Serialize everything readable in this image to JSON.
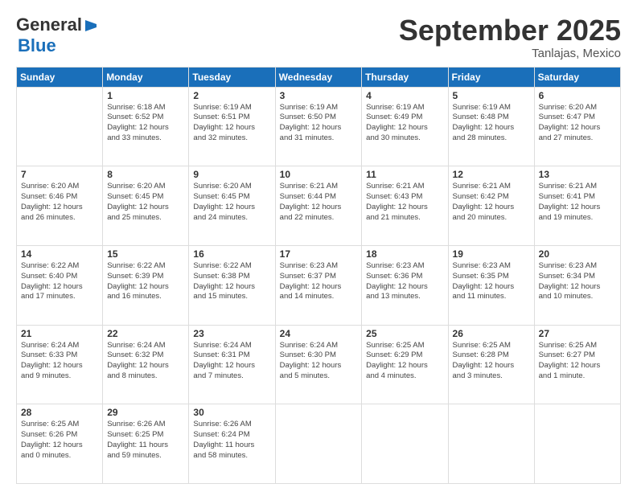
{
  "header": {
    "logo_general": "General",
    "logo_blue": "Blue",
    "title": "September 2025",
    "location": "Tanlajas, Mexico"
  },
  "calendar": {
    "headers": [
      "Sunday",
      "Monday",
      "Tuesday",
      "Wednesday",
      "Thursday",
      "Friday",
      "Saturday"
    ],
    "weeks": [
      [
        {
          "num": "",
          "info": ""
        },
        {
          "num": "1",
          "info": "Sunrise: 6:18 AM\nSunset: 6:52 PM\nDaylight: 12 hours\nand 33 minutes."
        },
        {
          "num": "2",
          "info": "Sunrise: 6:19 AM\nSunset: 6:51 PM\nDaylight: 12 hours\nand 32 minutes."
        },
        {
          "num": "3",
          "info": "Sunrise: 6:19 AM\nSunset: 6:50 PM\nDaylight: 12 hours\nand 31 minutes."
        },
        {
          "num": "4",
          "info": "Sunrise: 6:19 AM\nSunset: 6:49 PM\nDaylight: 12 hours\nand 30 minutes."
        },
        {
          "num": "5",
          "info": "Sunrise: 6:19 AM\nSunset: 6:48 PM\nDaylight: 12 hours\nand 28 minutes."
        },
        {
          "num": "6",
          "info": "Sunrise: 6:20 AM\nSunset: 6:47 PM\nDaylight: 12 hours\nand 27 minutes."
        }
      ],
      [
        {
          "num": "7",
          "info": "Sunrise: 6:20 AM\nSunset: 6:46 PM\nDaylight: 12 hours\nand 26 minutes."
        },
        {
          "num": "8",
          "info": "Sunrise: 6:20 AM\nSunset: 6:45 PM\nDaylight: 12 hours\nand 25 minutes."
        },
        {
          "num": "9",
          "info": "Sunrise: 6:20 AM\nSunset: 6:45 PM\nDaylight: 12 hours\nand 24 minutes."
        },
        {
          "num": "10",
          "info": "Sunrise: 6:21 AM\nSunset: 6:44 PM\nDaylight: 12 hours\nand 22 minutes."
        },
        {
          "num": "11",
          "info": "Sunrise: 6:21 AM\nSunset: 6:43 PM\nDaylight: 12 hours\nand 21 minutes."
        },
        {
          "num": "12",
          "info": "Sunrise: 6:21 AM\nSunset: 6:42 PM\nDaylight: 12 hours\nand 20 minutes."
        },
        {
          "num": "13",
          "info": "Sunrise: 6:21 AM\nSunset: 6:41 PM\nDaylight: 12 hours\nand 19 minutes."
        }
      ],
      [
        {
          "num": "14",
          "info": "Sunrise: 6:22 AM\nSunset: 6:40 PM\nDaylight: 12 hours\nand 17 minutes."
        },
        {
          "num": "15",
          "info": "Sunrise: 6:22 AM\nSunset: 6:39 PM\nDaylight: 12 hours\nand 16 minutes."
        },
        {
          "num": "16",
          "info": "Sunrise: 6:22 AM\nSunset: 6:38 PM\nDaylight: 12 hours\nand 15 minutes."
        },
        {
          "num": "17",
          "info": "Sunrise: 6:23 AM\nSunset: 6:37 PM\nDaylight: 12 hours\nand 14 minutes."
        },
        {
          "num": "18",
          "info": "Sunrise: 6:23 AM\nSunset: 6:36 PM\nDaylight: 12 hours\nand 13 minutes."
        },
        {
          "num": "19",
          "info": "Sunrise: 6:23 AM\nSunset: 6:35 PM\nDaylight: 12 hours\nand 11 minutes."
        },
        {
          "num": "20",
          "info": "Sunrise: 6:23 AM\nSunset: 6:34 PM\nDaylight: 12 hours\nand 10 minutes."
        }
      ],
      [
        {
          "num": "21",
          "info": "Sunrise: 6:24 AM\nSunset: 6:33 PM\nDaylight: 12 hours\nand 9 minutes."
        },
        {
          "num": "22",
          "info": "Sunrise: 6:24 AM\nSunset: 6:32 PM\nDaylight: 12 hours\nand 8 minutes."
        },
        {
          "num": "23",
          "info": "Sunrise: 6:24 AM\nSunset: 6:31 PM\nDaylight: 12 hours\nand 7 minutes."
        },
        {
          "num": "24",
          "info": "Sunrise: 6:24 AM\nSunset: 6:30 PM\nDaylight: 12 hours\nand 5 minutes."
        },
        {
          "num": "25",
          "info": "Sunrise: 6:25 AM\nSunset: 6:29 PM\nDaylight: 12 hours\nand 4 minutes."
        },
        {
          "num": "26",
          "info": "Sunrise: 6:25 AM\nSunset: 6:28 PM\nDaylight: 12 hours\nand 3 minutes."
        },
        {
          "num": "27",
          "info": "Sunrise: 6:25 AM\nSunset: 6:27 PM\nDaylight: 12 hours\nand 1 minute."
        }
      ],
      [
        {
          "num": "28",
          "info": "Sunrise: 6:25 AM\nSunset: 6:26 PM\nDaylight: 12 hours\nand 0 minutes."
        },
        {
          "num": "29",
          "info": "Sunrise: 6:26 AM\nSunset: 6:25 PM\nDaylight: 11 hours\nand 59 minutes."
        },
        {
          "num": "30",
          "info": "Sunrise: 6:26 AM\nSunset: 6:24 PM\nDaylight: 11 hours\nand 58 minutes."
        },
        {
          "num": "",
          "info": ""
        },
        {
          "num": "",
          "info": ""
        },
        {
          "num": "",
          "info": ""
        },
        {
          "num": "",
          "info": ""
        }
      ]
    ]
  }
}
